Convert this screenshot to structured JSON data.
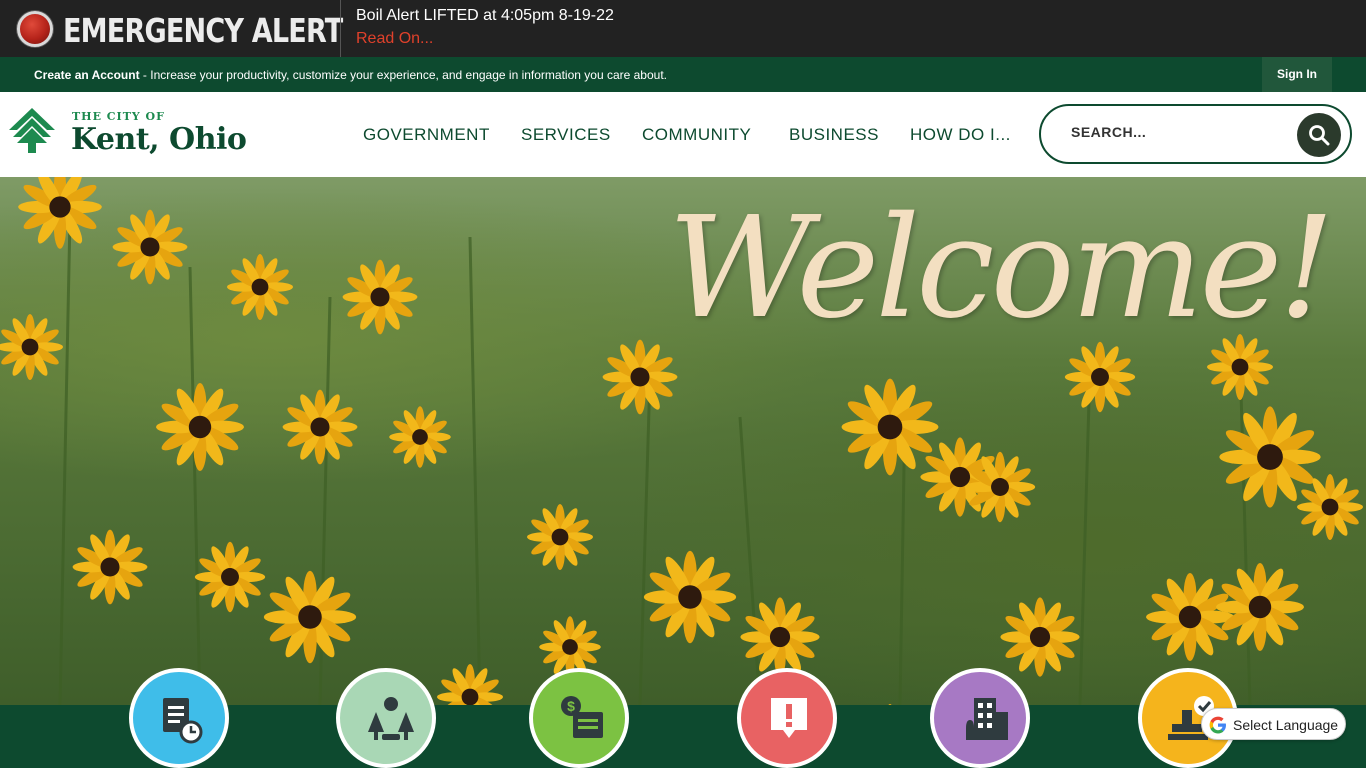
{
  "alert": {
    "title": "EMERGENCY ALERT",
    "message": "Boil Alert LIFTED at 4:05pm 8-19-22",
    "link": "Read On...",
    "dot_color": "#b5231a"
  },
  "account_bar": {
    "create_link": "Create an Account",
    "text": " - Increase your productivity, customize your experience, and engage in information you care about.",
    "sign_in": "Sign In"
  },
  "logo": {
    "small": "THE CITY OF",
    "big": "Kent, Ohio",
    "icon": "tree-icon"
  },
  "nav": [
    "GOVERNMENT",
    "SERVICES",
    "COMMUNITY",
    "BUSINESS",
    "HOW DO I..."
  ],
  "search": {
    "placeholder": "SEARCH...",
    "icon": "search-icon"
  },
  "hero": {
    "welcome": "Welcome!"
  },
  "quick_links": [
    {
      "icon": "document-clock-icon",
      "color": "#3fbde9"
    },
    {
      "icon": "trees-sun-icon",
      "color": "#a9d7b5"
    },
    {
      "icon": "payment-icon",
      "color": "#7cc242"
    },
    {
      "icon": "alert-icon",
      "color": "#e86263"
    },
    {
      "icon": "buildings-icon",
      "color": "#a779c4"
    },
    {
      "icon": "stamp-approved-icon",
      "color": "#f5b41c"
    }
  ],
  "translate": {
    "label": "Select Language",
    "icon": "google-icon"
  },
  "colors": {
    "brand_green": "#0d4a2f",
    "alert_red": "#e0412b"
  }
}
